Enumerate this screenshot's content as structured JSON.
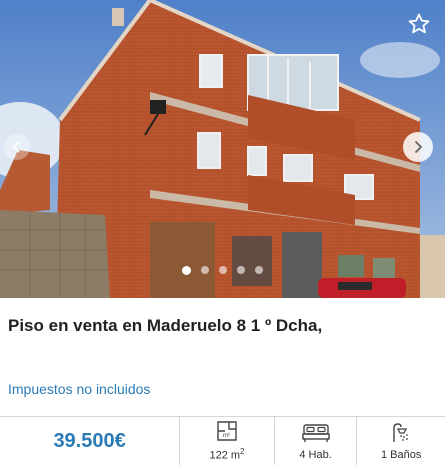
{
  "listing": {
    "title": "Piso en venta en Maderuelo 8 1 º Dcha,",
    "tax_note": "Impuestos no incluidos",
    "price": "39.500€"
  },
  "stats": {
    "area_value": "122 m",
    "area_sup": "2",
    "rooms": "4 Hab.",
    "baths": "1 Baños"
  },
  "gallery": {
    "image_count": 5,
    "current_index": 1
  },
  "colors": {
    "accent": "#2b7bb5",
    "brick": "#b8552e",
    "sky": "#6f98d4"
  },
  "icons": [
    "star-icon",
    "chevron-right-icon",
    "chevron-left-icon",
    "floor-plan-icon",
    "bed-icon",
    "shower-icon"
  ]
}
